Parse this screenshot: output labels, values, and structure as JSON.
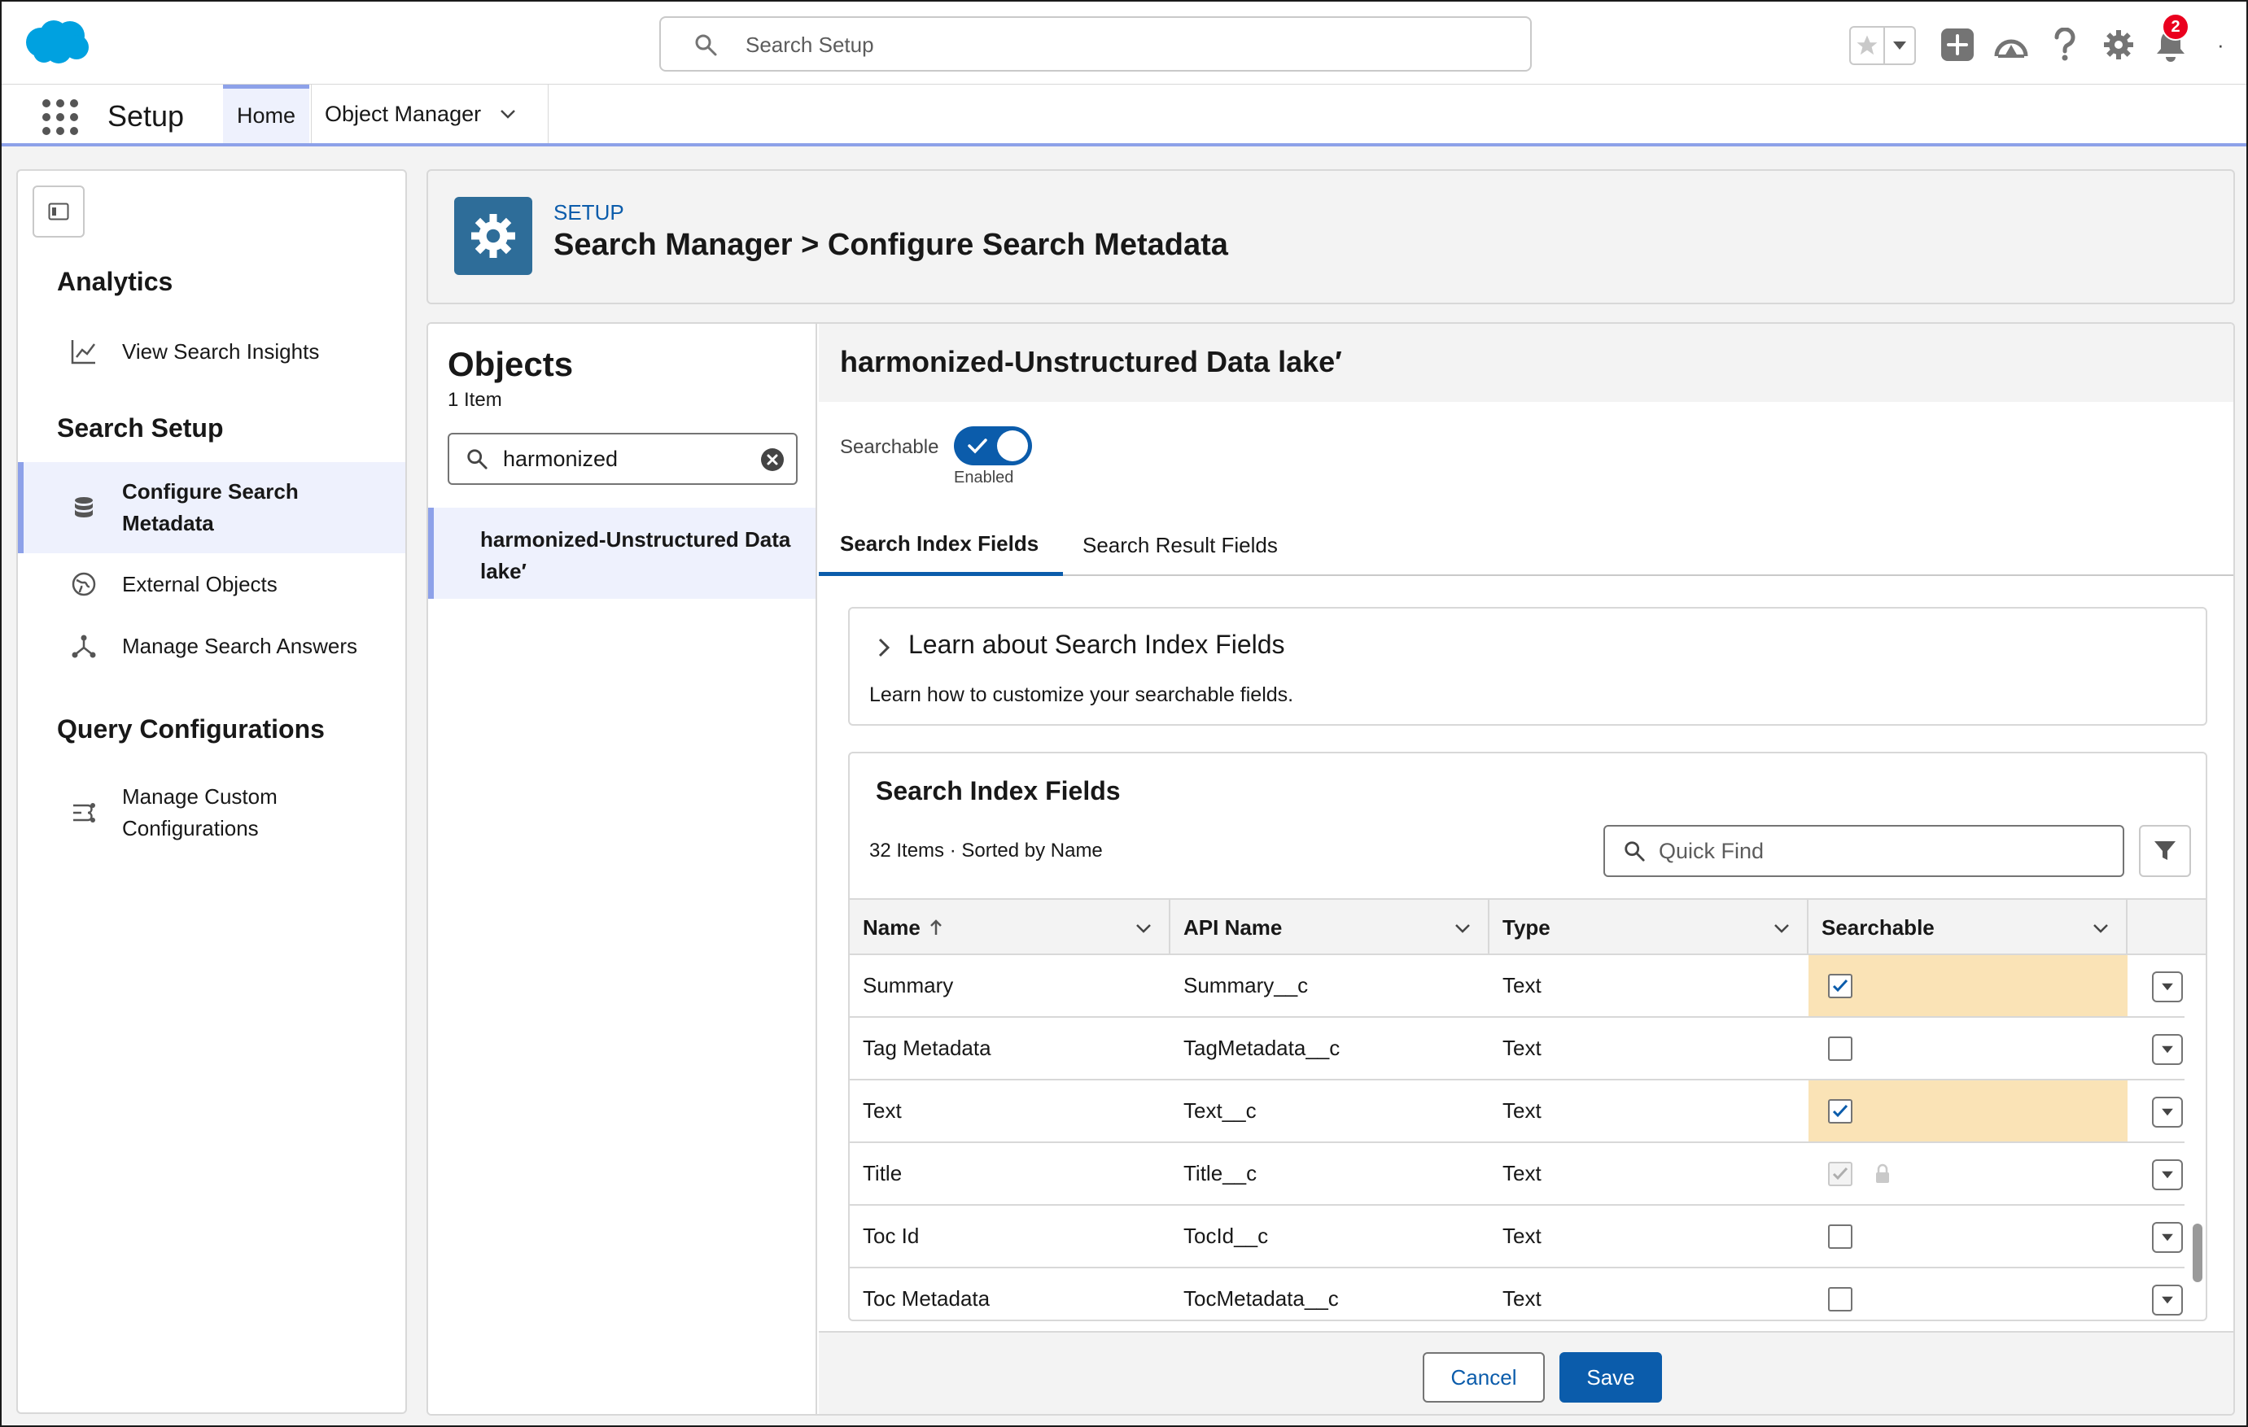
{
  "header": {
    "search_placeholder": "Search Setup",
    "notification_count": "2",
    "more": "·"
  },
  "nav": {
    "app_name": "Setup",
    "tabs": [
      {
        "label": "Home"
      },
      {
        "label": "Object Manager"
      }
    ]
  },
  "sidebar": {
    "sections": [
      {
        "heading": "Analytics",
        "items": [
          {
            "label": "View Search Insights",
            "icon": "chart-line-icon"
          }
        ]
      },
      {
        "heading": "Search Setup",
        "items": [
          {
            "label": "Configure Search Metadata",
            "icon": "database-icon"
          },
          {
            "label": "External Objects",
            "icon": "globe-icon"
          },
          {
            "label": "Manage Search Answers",
            "icon": "hierarchy-icon"
          }
        ]
      },
      {
        "heading": "Query Configurations",
        "items": [
          {
            "label": "Manage Custom Configurations",
            "icon": "flow-icon"
          }
        ]
      }
    ]
  },
  "page_header": {
    "eyebrow": "SETUP",
    "title": "Search Manager > Configure Search Metadata"
  },
  "objects": {
    "title": "Objects",
    "count": "1 Item",
    "search_value": "harmonized",
    "items": [
      {
        "label": "harmonized-Unstructured Data lake′"
      }
    ]
  },
  "detail": {
    "title": "harmonized-Unstructured Data lake′",
    "searchable_label": "Searchable",
    "searchable_state": "Enabled",
    "tabs": [
      {
        "label": "Search Index Fields"
      },
      {
        "label": "Search Result Fields"
      }
    ],
    "learn": {
      "heading": "Learn about Search Index Fields",
      "description": "Learn how to customize your searchable fields."
    },
    "fields": {
      "heading": "Search Index Fields",
      "meta": "32 Items  ·  Sorted by Name",
      "quick_find_placeholder": "Quick Find",
      "columns": [
        {
          "label": "Name"
        },
        {
          "label": "API Name"
        },
        {
          "label": "Type"
        },
        {
          "label": "Searchable"
        }
      ],
      "rows": [
        {
          "name": "Summary",
          "api": "Summary__c",
          "type": "Text",
          "searchable": true,
          "highlight": true,
          "locked": false
        },
        {
          "name": "Tag Metadata",
          "api": "TagMetadata__c",
          "type": "Text",
          "searchable": false,
          "highlight": false,
          "locked": false
        },
        {
          "name": "Text",
          "api": "Text__c",
          "type": "Text",
          "searchable": true,
          "highlight": true,
          "locked": false
        },
        {
          "name": "Title",
          "api": "Title__c",
          "type": "Text",
          "searchable": true,
          "highlight": false,
          "locked": true
        },
        {
          "name": "Toc Id",
          "api": "TocId__c",
          "type": "Text",
          "searchable": false,
          "highlight": false,
          "locked": false
        },
        {
          "name": "Toc Metadata",
          "api": "TocMetadata__c",
          "type": "Text",
          "searchable": false,
          "highlight": false,
          "locked": false
        }
      ]
    }
  },
  "footer": {
    "cancel_label": "Cancel",
    "save_label": "Save"
  },
  "colors": {
    "brand_blue": "#0b5cab",
    "accent_lavender": "#8da1e9",
    "highlight_yellow": "#fae3b6",
    "salesforce_cloud": "#00a1e0"
  }
}
